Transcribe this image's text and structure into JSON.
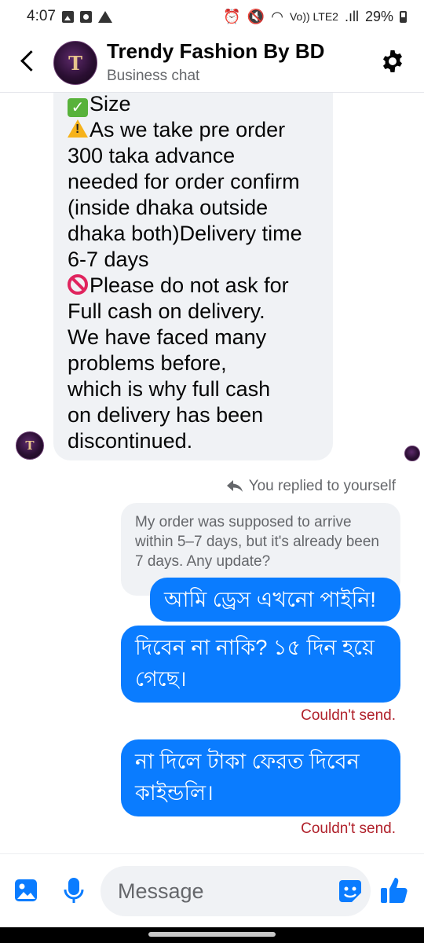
{
  "status_bar": {
    "time": "4:07",
    "icons_left": [
      "photo-icon",
      "notification-icon",
      "warning-icon"
    ],
    "network_small": "Vo)) LTE2",
    "signal": ".ıll",
    "battery": "29%"
  },
  "header": {
    "title": "Trendy Fashion By BD",
    "subtitle": "Business chat",
    "avatar_text": "T"
  },
  "incoming_message": {
    "lines": [
      {
        "emoji": "check",
        "text": "Size"
      },
      {
        "emoji": "warning",
        "text": "As we take pre order"
      },
      {
        "emoji": "",
        "text": "300 taka advance"
      },
      {
        "emoji": "",
        "text": "needed for order confirm"
      },
      {
        "emoji": "",
        "text": "(inside dhaka outside"
      },
      {
        "emoji": "",
        "text": "dhaka both)Delivery time"
      },
      {
        "emoji": "",
        "text": "6-7 days"
      },
      {
        "emoji": "prohibited",
        "text": "Please do not ask for"
      },
      {
        "emoji": "",
        "text": "Full cash on delivery."
      },
      {
        "emoji": "",
        "text": "We have faced many"
      },
      {
        "emoji": "",
        "text": "problems before,"
      },
      {
        "emoji": "",
        "text": "which is why full cash"
      },
      {
        "emoji": "",
        "text": "on delivery has been"
      },
      {
        "emoji": "",
        "text": "discontinued."
      }
    ]
  },
  "reply": {
    "label": "You replied to yourself",
    "quoted_text": "My order was supposed to arrive within 5–7 days, but it's already been 7 days. Any update?"
  },
  "outgoing_messages": [
    {
      "text": "আমি ড্রেস এখনো পাইনি!",
      "status": ""
    },
    {
      "text": "দিবেন না নাকি? ১৫ দিন হয়ে গেছে।",
      "status": "Couldn't send."
    },
    {
      "text": "না দিলে টাকা ফেরত দিবেন কাইন্ডলি।",
      "status": "Couldn't send."
    }
  ],
  "composer": {
    "placeholder": "Message"
  },
  "colors": {
    "outgoing_bubble": "#0a7cff",
    "incoming_bubble": "#f0f2f5",
    "error_text": "#b0212b",
    "accent": "#0a7cff"
  }
}
